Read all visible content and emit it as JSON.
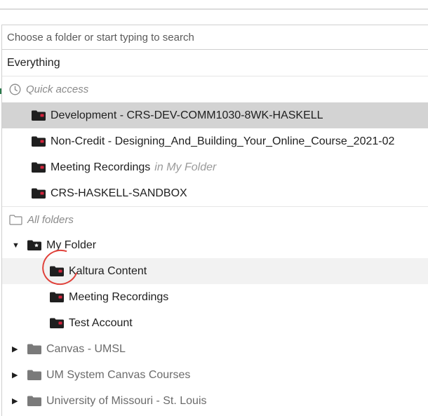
{
  "search": {
    "placeholder": "Choose a folder or start typing to search"
  },
  "everything_label": "Everything",
  "quick_access": {
    "heading": "Quick access",
    "items": [
      {
        "label": "Development - CRS-DEV-COMM1030-8WK-HASKELL",
        "suffix": ""
      },
      {
        "label": "Non-Credit - Designing_And_Building_Your_Online_Course_2021-02",
        "suffix": ""
      },
      {
        "label": "Meeting Recordings",
        "suffix": "in My Folder"
      },
      {
        "label": "CRS-HASKELL-SANDBOX",
        "suffix": ""
      }
    ]
  },
  "all_folders": {
    "heading": "All folders",
    "my_folder": {
      "label": "My Folder",
      "children": [
        "Kaltura Content",
        "Meeting Recordings",
        "Test Account"
      ]
    },
    "others": [
      "Canvas - UMSL",
      "UM System Canvas Courses",
      "University of Missouri - St. Louis"
    ]
  },
  "colors": {
    "selected_bg": "#d3d3d3",
    "hover_bg": "#f2f2f2",
    "folder_dark": "#1f1f1f",
    "folder_gray": "#7a7a7a",
    "folder_badge": "#d4233c",
    "highlight_ring": "#e0413a"
  }
}
